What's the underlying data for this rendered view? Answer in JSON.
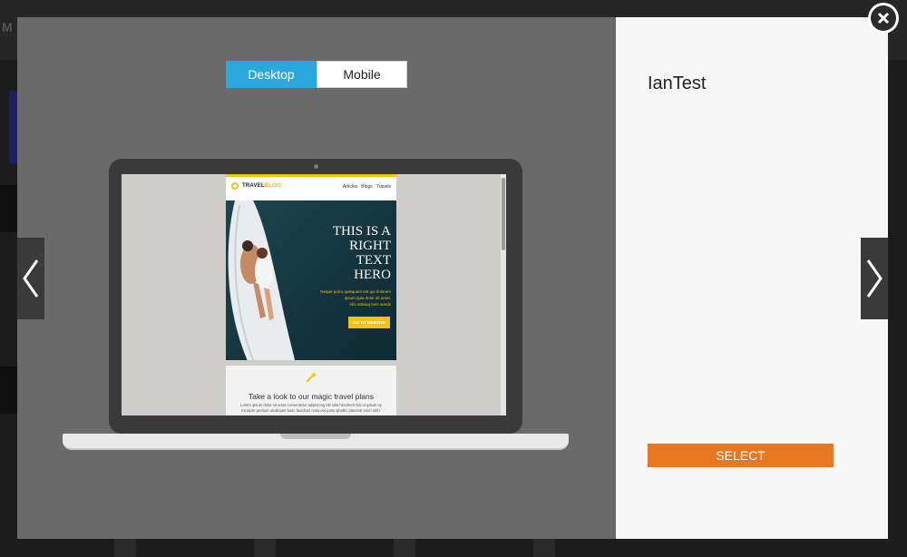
{
  "background": {
    "partial_label": "M"
  },
  "preview": {
    "toggle": {
      "desktop_label": "Desktop",
      "mobile_label": "Mobile",
      "active": "Desktop"
    },
    "email": {
      "brand_part1": "TRAVEL",
      "brand_part2": "BLOG",
      "nav": [
        "Articles",
        "Blogs",
        "Travels"
      ],
      "hero_title_lines": [
        "THIS IS A",
        "RIGHT",
        "TEXT",
        "HERO"
      ],
      "hero_copy_lines": [
        "Neque porro quisquam est qui dolorem",
        "ipsum quia dolor sit amet.",
        "Alis sobisaj nem seeds"
      ],
      "hero_cta": "GO TO WEBSITE",
      "plans_title": "Take a look to our magic travel plans",
      "plans_text": "Lorem ipsum dolor sit amet consectetur adipiscing elit iulia hendrerit nisi ut ipsum ny mcorper pretium ulcaliquet busc faucibus casa erit justo sjhafkc placerat enim nibh.",
      "accent_color": "#f5c400"
    }
  },
  "info": {
    "template_name": "IanTest",
    "select_label": "SELECT",
    "select_color": "#e87722"
  },
  "controls": {
    "toggle_active_color": "#2aa8de",
    "prev_icon": "chevron-left-icon",
    "next_icon": "chevron-right-icon",
    "close_icon": "close-icon"
  }
}
